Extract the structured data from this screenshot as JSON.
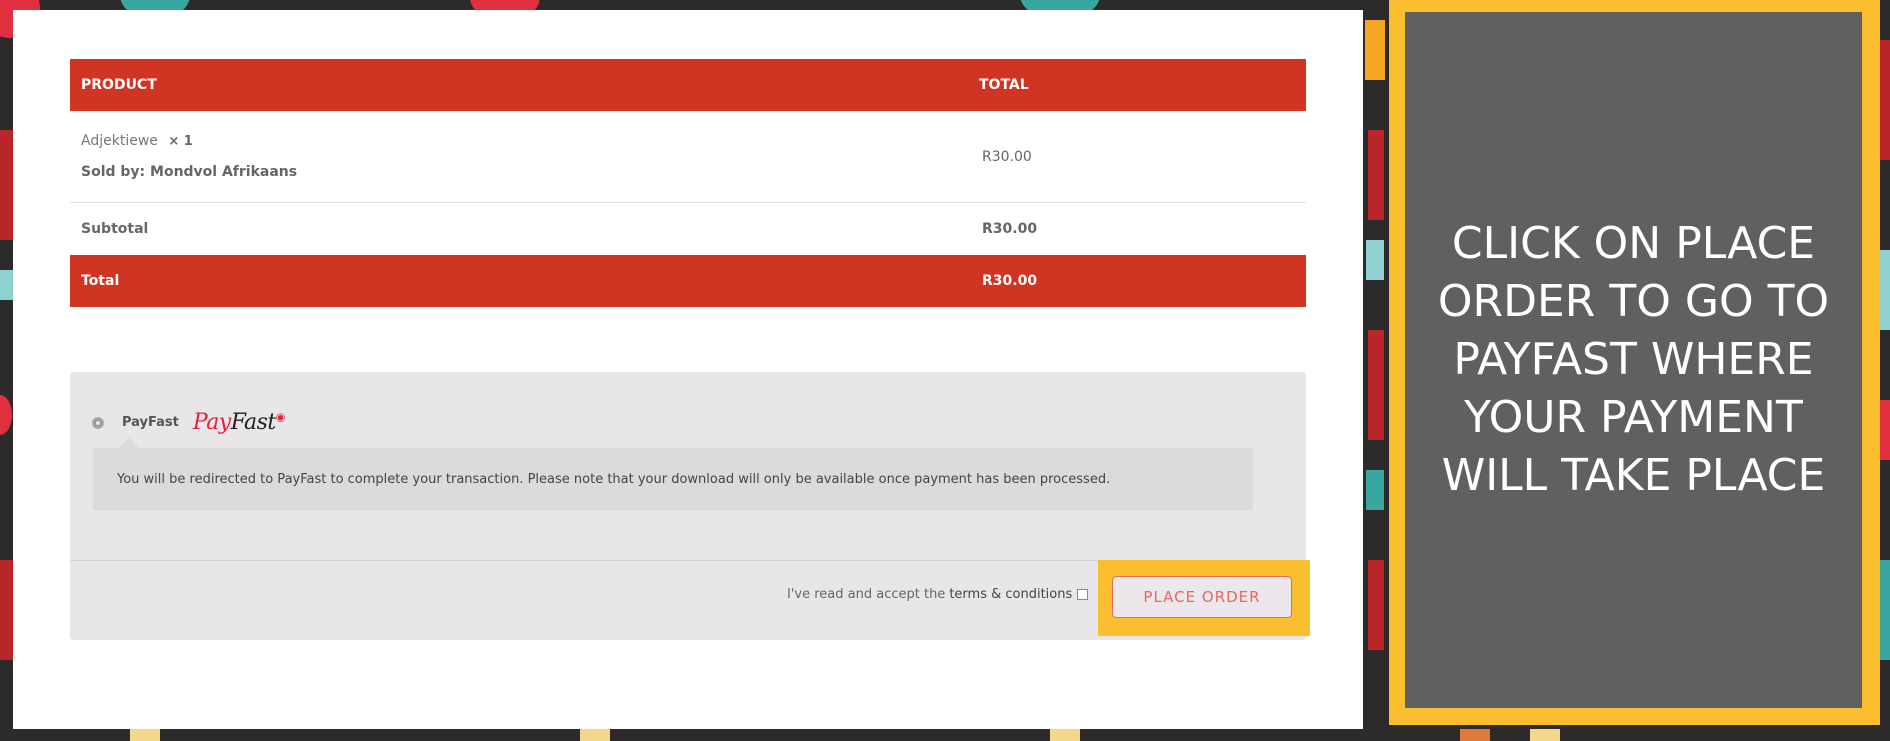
{
  "order_table": {
    "header": {
      "product": "PRODUCT",
      "total": "TOTAL"
    },
    "item": {
      "name": "Adjektiewe",
      "quantity": "× 1",
      "sold_by": "Sold by: Mondvol Afrikaans",
      "price": "R30.00"
    },
    "subtotal": {
      "label": "Subtotal",
      "value": "R30.00"
    },
    "total": {
      "label": "Total",
      "value": "R30.00"
    }
  },
  "payment": {
    "method_label": "PayFast",
    "logo": {
      "part1": "Pay",
      "part2": "Fast"
    },
    "description": "You will be redirected to PayFast to complete your transaction. Please note that your download will only be available once payment has been processed.",
    "terms_text": "I've read and accept the",
    "terms_link": "terms & conditions",
    "place_order": "PLACE ORDER"
  },
  "callout": {
    "text": "CLICK ON PLACE ORDER TO GO TO PAYFAST WHERE YOUR PAYMENT WILL TAKE PLACE"
  },
  "colors": {
    "brand_red": "#d03524",
    "highlight_yellow": "#fbbe2e",
    "callout_gray": "#606060",
    "panel_gray": "#e8e6e8"
  }
}
